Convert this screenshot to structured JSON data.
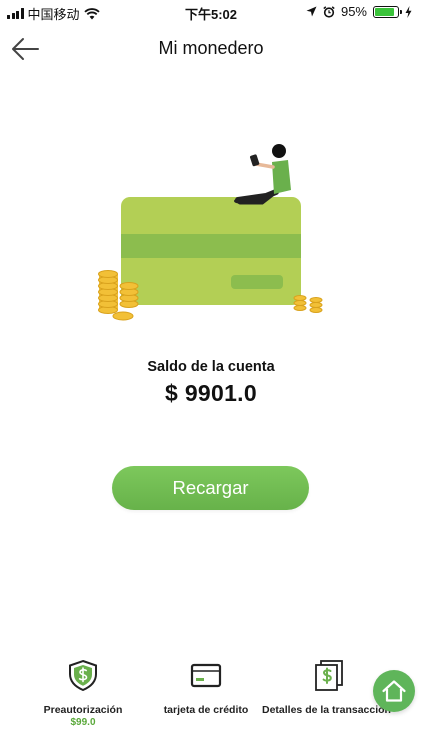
{
  "status_bar": {
    "carrier": "中国移动",
    "time": "下午5:02",
    "battery_percent": "95%",
    "battery_level": 0.95,
    "icons": [
      "signal-icon",
      "wifi-icon",
      "location-icon",
      "alarm-icon",
      "battery-icon",
      "charging-icon"
    ]
  },
  "nav": {
    "title": "Mi monedero",
    "back_icon": "arrow-left-icon"
  },
  "wallet": {
    "balance_label": "Saldo de la cuenta",
    "balance_value": "$ 9901.0"
  },
  "actions": {
    "recharge_label": "Recargar"
  },
  "bottom_menu": {
    "items": [
      {
        "label": "Preautorización",
        "sub": "$99.0",
        "icon": "shield-dollar-icon"
      },
      {
        "label": "tarjeta de crédito",
        "sub": "",
        "icon": "credit-card-icon"
      },
      {
        "label": "Detalles de la transacción",
        "sub": "",
        "icon": "documents-dollar-icon"
      }
    ],
    "home_icon": "home-icon"
  },
  "colors": {
    "accent_green": "#67b24a",
    "card_green": "#b3cf55",
    "card_stripe": "#8cbd4e",
    "coin_gold": "#f2c037",
    "sub_text_green": "#5aa83a",
    "home_button": "#5fb55a"
  }
}
